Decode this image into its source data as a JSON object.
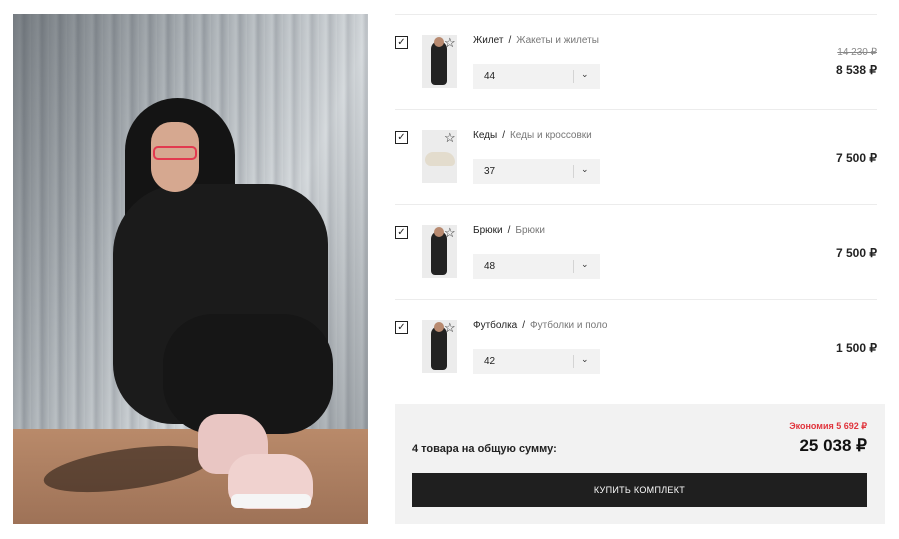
{
  "items": [
    {
      "name": "Жилет",
      "category": "Жакеты и жилеты",
      "size": "44",
      "old_price": "14 230 ₽",
      "price": "8 538 ₽",
      "checked": "✓"
    },
    {
      "name": "Кеды",
      "category": "Кеды и кроссовки",
      "size": "37",
      "price": "7 500 ₽",
      "checked": "✓"
    },
    {
      "name": "Брюки",
      "category": "Брюки",
      "size": "48",
      "price": "7 500 ₽",
      "checked": "✓"
    },
    {
      "name": "Футболка",
      "category": "Футболки и поло",
      "size": "42",
      "price": "1 500 ₽",
      "checked": "✓"
    }
  ],
  "separator": "/",
  "summary": {
    "economy": "Экономия 5 692 ₽",
    "label": "4 товара на общую сумму:",
    "total": "25 038 ₽",
    "buy_label": "КУПИТЬ КОМПЛЕКТ"
  },
  "icons": {
    "favorite": "☆",
    "chevron": "⌄"
  },
  "colors": {
    "accent_red": "#e0343c",
    "button_bg": "#1f1f1f",
    "summary_bg": "#f2f2f2"
  }
}
